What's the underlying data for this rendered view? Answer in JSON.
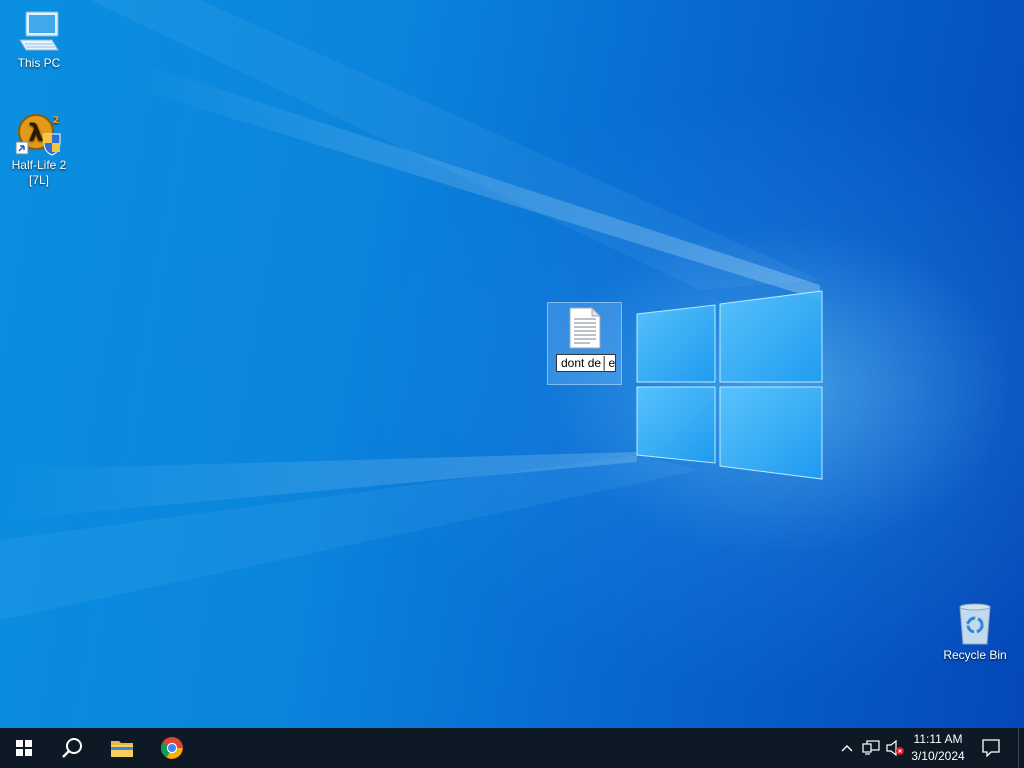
{
  "desktop": {
    "icons": [
      {
        "label": "This PC",
        "icon": "computer-icon"
      },
      {
        "label_line1": "Half-Life 2",
        "label_line2": "[7L]",
        "icon": "half-life-2-icon"
      },
      {
        "rename_value": "dont de│e",
        "icon": "text-document-icon"
      },
      {
        "label": "Recycle Bin",
        "icon": "recycle-bin-icon"
      }
    ]
  },
  "taskbar": {
    "start_icon": "windows-logo-icon",
    "search_icon": "search-icon",
    "apps": [
      {
        "icon": "file-explorer-icon"
      },
      {
        "icon": "chrome-icon"
      }
    ],
    "tray": {
      "chevron_icon": "chevron-up-icon",
      "network_icon": "network-icon",
      "volume_icon": "volume-muted-icon",
      "notification_icon": "notification-icon"
    },
    "clock": {
      "time": "11:11 AM",
      "date": "3/10/2024"
    }
  },
  "colors": {
    "taskbar": "#0d1a26",
    "desktop_accent": "#0a8fe0"
  }
}
